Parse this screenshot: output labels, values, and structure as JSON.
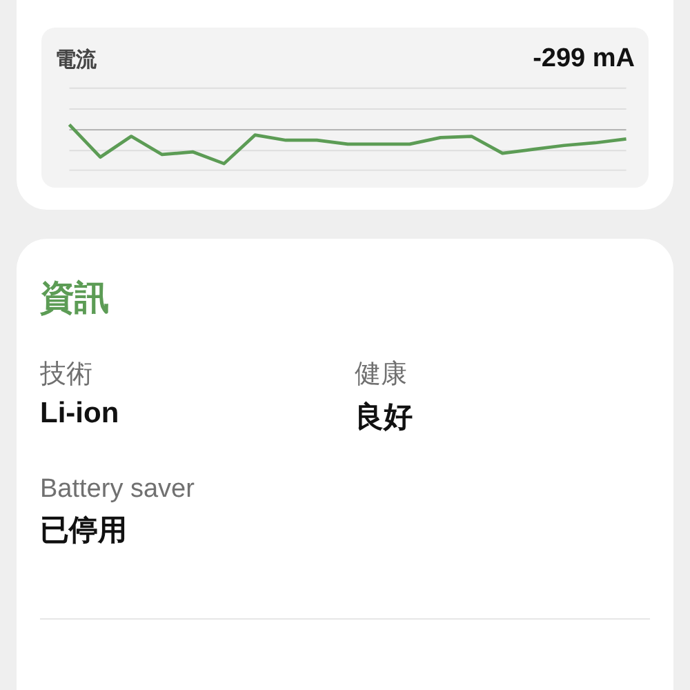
{
  "current_card": {
    "label": "電流",
    "reading": "-299 mA"
  },
  "info_card": {
    "title": "資訊",
    "fields": [
      {
        "label": "技術",
        "value": "Li-ion"
      },
      {
        "label": "健康",
        "value": "良好"
      },
      {
        "label": "Battery saver",
        "value": "已停用"
      }
    ]
  }
}
